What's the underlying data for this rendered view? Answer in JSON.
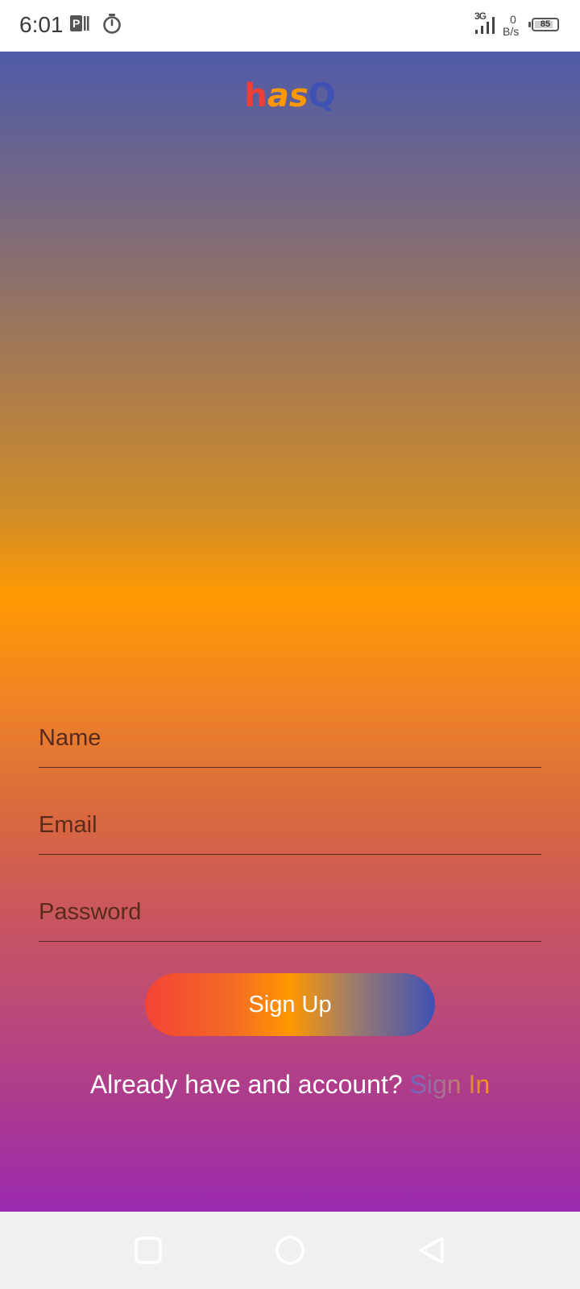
{
  "status_bar": {
    "time": "6:01",
    "network_type": "3G",
    "net_speed_value": "0",
    "net_speed_unit": "B/s",
    "battery_level": "85",
    "battery_percent": 0.85,
    "icons": [
      "parking-app-icon",
      "timer-icon",
      "signal-icon",
      "battery-icon"
    ]
  },
  "app": {
    "logo_parts": [
      "h",
      "as",
      "Q"
    ],
    "name_placeholder": "Name",
    "email_placeholder": "Email",
    "password_placeholder": "Password",
    "signup_label": "Sign Up",
    "signin_prompt": "Already have and account?",
    "signin_link": "Sign In"
  },
  "colors": {
    "logo_h": "#ef3e36",
    "logo_as": "#ff9800",
    "logo_q": "#3f51b5",
    "gradient_top": "#4f5aa8",
    "gradient_mid": "#ff9a00",
    "gradient_bottom": "#9b2ab0"
  },
  "nav_bar": {
    "icons": [
      "recents-icon",
      "home-icon",
      "back-icon"
    ]
  }
}
